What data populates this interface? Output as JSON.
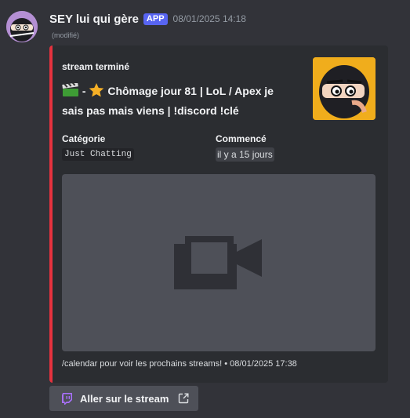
{
  "message": {
    "username": "SEY lui qui gère",
    "badge": "APP",
    "timestamp": "08/01/2025 14:18",
    "edited": "(modifié)"
  },
  "embed": {
    "accent_color": "#e5323e",
    "author": "stream terminé",
    "title_icon_1": "clapperboard-icon",
    "title_icon_2": "star-icon",
    "title_prefix": "-",
    "title_text": "Chômage jour 81 | LoL / Apex je sais pas mais viens | !discord !clé",
    "fields": [
      {
        "name": "Catégorie",
        "value": "Just Chatting"
      },
      {
        "name": "Commencé",
        "value": "il y a 15 jours"
      }
    ],
    "footer_text": "/calendar pour voir les prochains streams! • 08/01/2025 17:38"
  },
  "button": {
    "label": "Aller sur le stream",
    "icon": "twitch-icon",
    "trailing_icon": "external-link-icon"
  },
  "colors": {
    "background": "#323339",
    "embed_background": "#2b2d31",
    "badge": "#5865f2",
    "button": "#4e5058"
  }
}
